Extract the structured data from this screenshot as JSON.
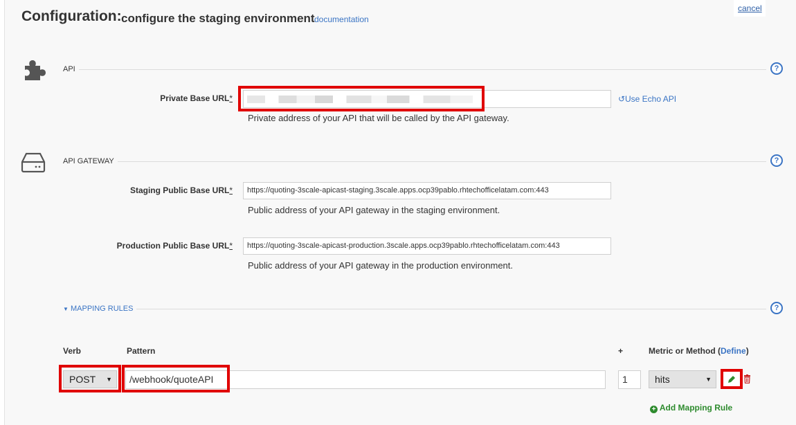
{
  "header": {
    "title": "Configuration:",
    "subtitle": "configure the staging environment",
    "documentation_link": "documentation",
    "cancel_link": "cancel"
  },
  "api_section": {
    "label": "API",
    "help": "?",
    "private_base_url": {
      "label": "Private Base URL",
      "required_mark": "*",
      "value": "",
      "hint": "Private address of your API that will be called by the API gateway."
    },
    "use_echo_api": "Use Echo API"
  },
  "gateway_section": {
    "label": "API GATEWAY",
    "help": "?",
    "staging": {
      "label": "Staging Public Base URL",
      "required_mark": "*",
      "value": "https://quoting-3scale-apicast-staging.3scale.apps.ocp39pablo.rhtechofficelatam.com:443",
      "hint": "Public address of your API gateway in the staging environment."
    },
    "production": {
      "label": "Production Public Base URL",
      "required_mark": "*",
      "value": "https://quoting-3scale-apicast-production.3scale.apps.ocp39pablo.rhtechofficelatam.com:443",
      "hint": "Public address of your API gateway in the production environment."
    }
  },
  "mapping_rules": {
    "label": "MAPPING RULES",
    "help": "?",
    "columns": {
      "verb": "Verb",
      "pattern": "Pattern",
      "plus": "+",
      "metric_prefix": "Metric or Method (",
      "define": "Define",
      "metric_suffix": ")"
    },
    "rows": [
      {
        "verb": "POST",
        "pattern": "/webhook/quoteAPI",
        "delta": "1",
        "metric": "hits"
      }
    ],
    "add_rule": "Add Mapping Rule"
  },
  "colors": {
    "link": "#3a74c4",
    "highlight": "#e00000",
    "add_green": "#2e8b2e",
    "delete_red": "#cc2222"
  }
}
